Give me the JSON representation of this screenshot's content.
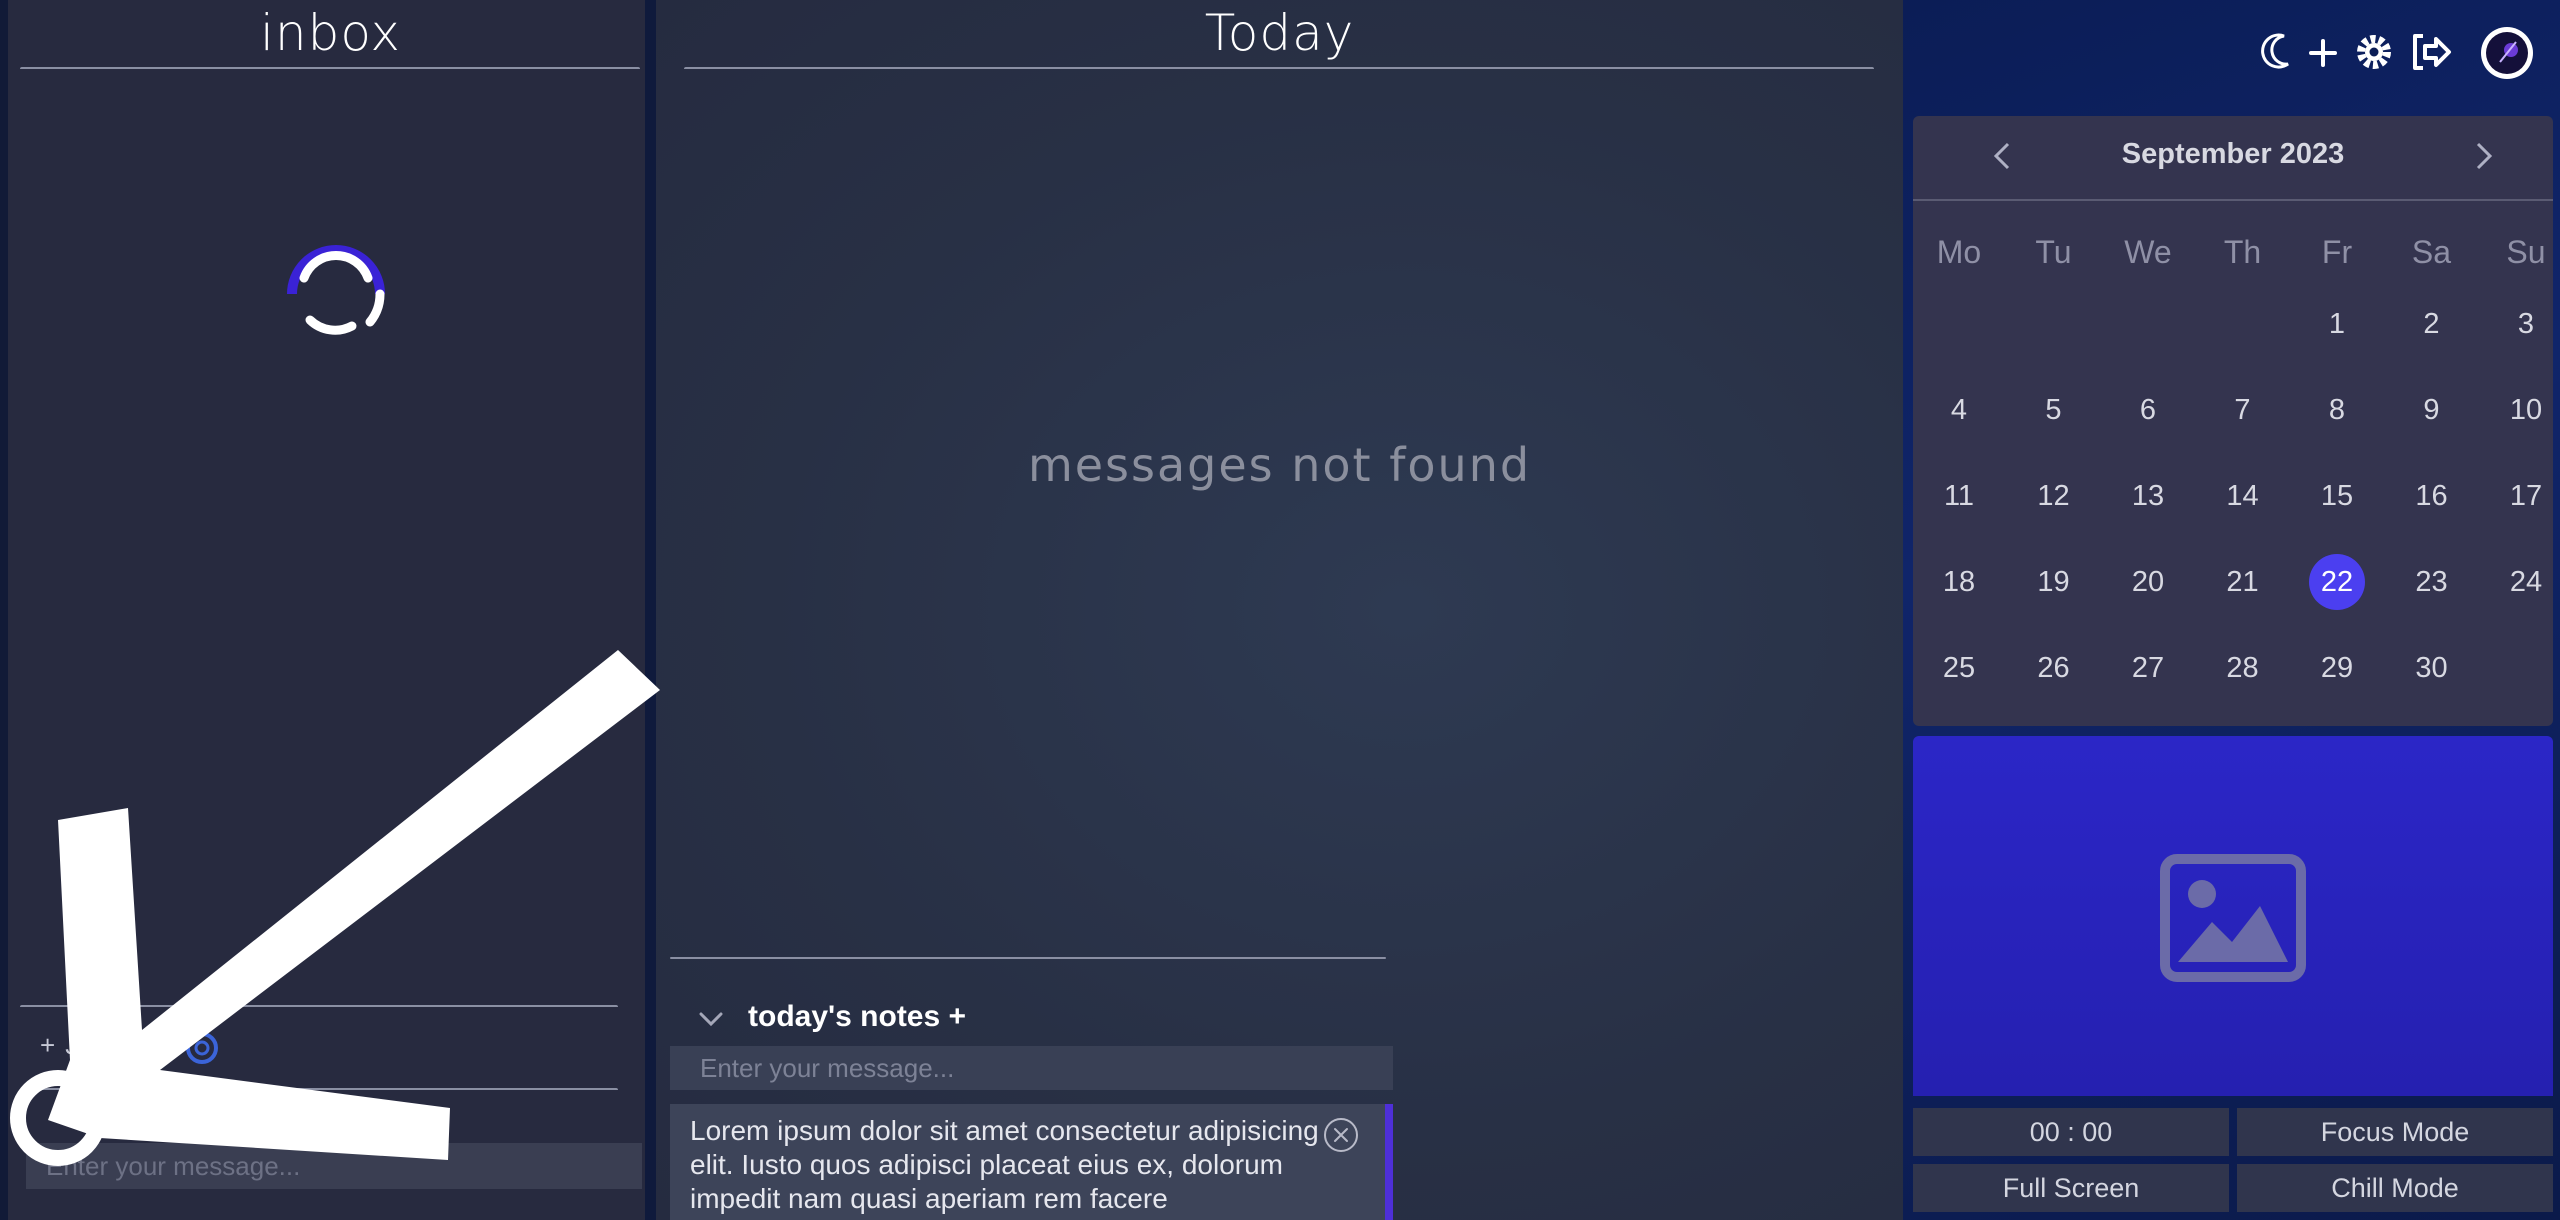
{
  "inbox": {
    "title": "inbox",
    "add_label": "Jesk",
    "backlog_label": "backlog",
    "input_placeholder": "Enter your message..."
  },
  "today": {
    "title": "Today",
    "empty_message": "messages not found",
    "notes_title": "today's notes +",
    "notes_input_placeholder": "Enter your message...",
    "note_text": "Lorem ipsum dolor sit amet consectetur adipisicing elit. Iusto quos adipisci placeat eius ex, dolorum impedit nam quasi aperiam rem facere"
  },
  "toolbar": {
    "icons": [
      "moon-icon",
      "plus-icon",
      "gear-icon",
      "logout-icon",
      "avatar"
    ]
  },
  "calendar": {
    "month_label": "September 2023",
    "weekdays": [
      "Mo",
      "Tu",
      "We",
      "Th",
      "Fr",
      "Sa",
      "Su"
    ],
    "first_weekday_index": 4,
    "days_in_month": 30,
    "selected_day": 22
  },
  "timer": {
    "display": "00 : 00",
    "focus_label": "Focus Mode",
    "fullscreen_label": "Full Screen",
    "chill_label": "Chill Mode"
  },
  "colors": {
    "accent": "#4b3ff0",
    "spinner_accent": "#3a22d6",
    "image_panel": "#2b26c7"
  }
}
